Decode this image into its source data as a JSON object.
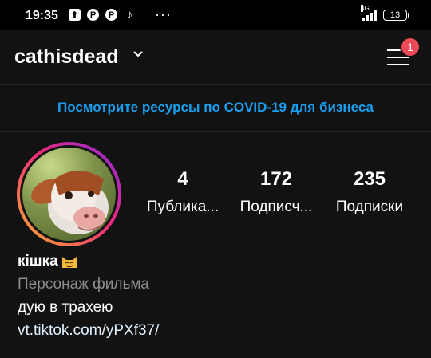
{
  "status_bar": {
    "time": "19:35",
    "notification_icons": [
      "box-arrow-icon",
      "pinterest-icon",
      "pinterest-icon",
      "tiktok-icon"
    ],
    "more": "···",
    "network": "4G",
    "battery": "13"
  },
  "header": {
    "username": "cathisdead",
    "menu_badge": "1"
  },
  "banner": {
    "text": "Посмотрите ресурсы по COVID-19 для бизнеса"
  },
  "profile": {
    "stats": [
      {
        "value": "4",
        "label": "Публика..."
      },
      {
        "value": "172",
        "label": "Подписч..."
      },
      {
        "value": "235",
        "label": "Подписки"
      }
    ],
    "name": "кішка",
    "category": "Персонаж фильма",
    "bio": "дую в трахею",
    "link": "vt.tiktok.com/yPXf37/"
  },
  "colors": {
    "accent_link": "#1a9ff0",
    "badge": "#ed4956",
    "background": "#121212"
  }
}
